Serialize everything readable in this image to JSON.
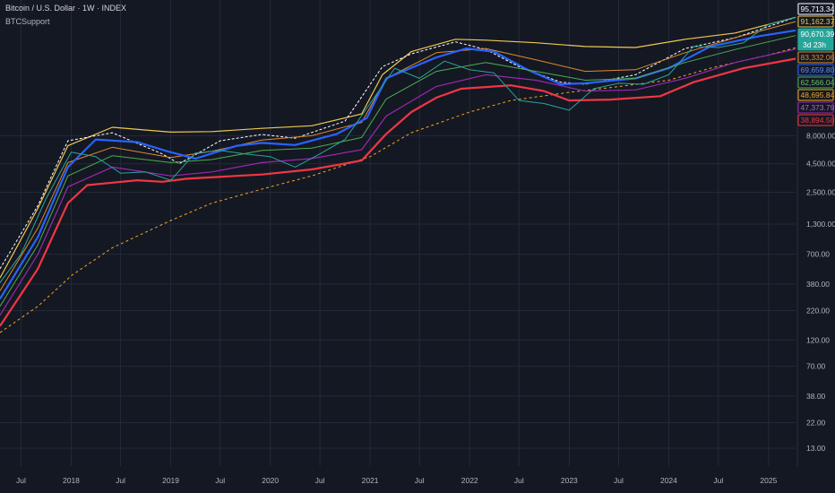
{
  "header": {
    "title": "Bitcoin / U.S. Dollar · 1W · INDEX",
    "indicator": "BTCSupport"
  },
  "colors": {
    "background": "#141823",
    "grid": "#242938",
    "up_candle": "#26a69a",
    "down_candle": "#ef5350"
  },
  "chart_data": {
    "type": "line",
    "title": "Bitcoin / U.S. Dollar · 1W · INDEX",
    "y_scale": "log",
    "grid": true,
    "ylim": [
      9,
      130000
    ],
    "x_range": [
      "2017-04-15",
      "2025-04-10"
    ],
    "y_ticks": [
      "8,000.00",
      "4,500.00",
      "2,500.00",
      "1,300.00",
      "700.00",
      "380.00",
      "220.00",
      "120.00",
      "70.00",
      "38.00",
      "22.00",
      "13.00"
    ],
    "x_ticks": [
      {
        "label": "Jul",
        "date": "2017-07-01"
      },
      {
        "label": "2018",
        "date": "2018-01-01"
      },
      {
        "label": "Jul",
        "date": "2018-07-01"
      },
      {
        "label": "2019",
        "date": "2019-01-01"
      },
      {
        "label": "Jul",
        "date": "2019-07-01"
      },
      {
        "label": "2020",
        "date": "2020-01-01"
      },
      {
        "label": "Jul",
        "date": "2020-07-01"
      },
      {
        "label": "2021",
        "date": "2021-01-01"
      },
      {
        "label": "Jul",
        "date": "2021-07-01"
      },
      {
        "label": "2022",
        "date": "2022-01-01"
      },
      {
        "label": "Jul",
        "date": "2022-07-01"
      },
      {
        "label": "2023",
        "date": "2023-01-01"
      },
      {
        "label": "Jul",
        "date": "2023-07-01"
      },
      {
        "label": "2024",
        "date": "2024-01-01"
      },
      {
        "label": "Jul",
        "date": "2024-07-01"
      },
      {
        "label": "2025",
        "date": "2025-01-01"
      }
    ],
    "price_tags": [
      {
        "value": "95,713.34",
        "price": 95713.34,
        "color": "#ffffff",
        "bg": "#141823",
        "fg": "#ffffff"
      },
      {
        "value": "91,162.37",
        "price": 91162.37,
        "color": "#f0c850",
        "bg": "#141823",
        "fg": "#f0c850"
      },
      {
        "value": "90,670.39",
        "price": 90670.39,
        "color": "#26a69a",
        "bg": "#26a69a",
        "fg": "#ffffff",
        "sub": "3d 23h"
      },
      {
        "value": "83,332.06",
        "price": 83332.06,
        "color": "#e08a2c",
        "bg": "#141823",
        "fg": "#e08a2c"
      },
      {
        "value": "69,659.80",
        "price": 69659.8,
        "color": "#2962ff",
        "bg": "#141823",
        "fg": "#5b8cff"
      },
      {
        "value": "62,566.04",
        "price": 62566.04,
        "color": "#4caf50",
        "bg": "#141823",
        "fg": "#6cc070"
      },
      {
        "value": "48,695.84",
        "price": 48695.84,
        "color": "#f5a623",
        "bg": "#141823",
        "fg": "#f5a623"
      },
      {
        "value": "47,373.79",
        "price": 47373.79,
        "color": "#9c27b0",
        "bg": "#141823",
        "fg": "#b06ad0"
      },
      {
        "value": "38,894.50",
        "price": 38894.5,
        "color": "#f23645",
        "bg": "#141823",
        "fg": "#f23645"
      }
    ],
    "series": [
      {
        "color": "#f0c850",
        "width": 1.2,
        "dash": "",
        "points": [
          [
            "2017-04-15",
            430
          ],
          [
            "2017-09-01",
            1800
          ],
          [
            "2017-12-20",
            6500
          ],
          [
            "2018-06-01",
            9500
          ],
          [
            "2019-01-01",
            8600
          ],
          [
            "2019-06-01",
            8700
          ],
          [
            "2019-12-01",
            9300
          ],
          [
            "2020-06-01",
            9800
          ],
          [
            "2020-12-01",
            12500
          ],
          [
            "2021-02-15",
            28000
          ],
          [
            "2021-06-01",
            45000
          ],
          [
            "2021-11-10",
            58000
          ],
          [
            "2022-03-01",
            57000
          ],
          [
            "2022-09-01",
            54000
          ],
          [
            "2023-03-01",
            50000
          ],
          [
            "2023-09-01",
            49000
          ],
          [
            "2024-03-01",
            58000
          ],
          [
            "2024-09-01",
            66000
          ],
          [
            "2025-04-10",
            91162.37
          ]
        ]
      },
      {
        "color": "#ffffff",
        "width": 1,
        "dash": "3,2",
        "points": [
          [
            "2017-04-15",
            520
          ],
          [
            "2017-09-01",
            1900
          ],
          [
            "2017-12-20",
            7200
          ],
          [
            "2018-06-01",
            8500
          ],
          [
            "2018-12-01",
            5500
          ],
          [
            "2019-02-01",
            4500
          ],
          [
            "2019-07-01",
            7200
          ],
          [
            "2019-12-01",
            8200
          ],
          [
            "2020-04-01",
            7600
          ],
          [
            "2020-10-01",
            10800
          ],
          [
            "2021-02-15",
            33000
          ],
          [
            "2021-06-01",
            43000
          ],
          [
            "2021-11-10",
            55000
          ],
          [
            "2022-03-01",
            47000
          ],
          [
            "2022-07-01",
            33000
          ],
          [
            "2022-12-01",
            24000
          ],
          [
            "2023-03-01",
            23000
          ],
          [
            "2023-09-01",
            28000
          ],
          [
            "2024-03-01",
            48000
          ],
          [
            "2024-09-01",
            60000
          ],
          [
            "2025-04-10",
            91000
          ]
        ]
      },
      {
        "color": "#e08a2c",
        "width": 1,
        "dash": "",
        "points": [
          [
            "2017-04-15",
            330
          ],
          [
            "2017-09-01",
            1200
          ],
          [
            "2017-12-20",
            4600
          ],
          [
            "2018-06-01",
            6300
          ],
          [
            "2019-01-01",
            5100
          ],
          [
            "2019-06-01",
            5800
          ],
          [
            "2019-12-01",
            7300
          ],
          [
            "2020-06-01",
            8000
          ],
          [
            "2020-12-01",
            10500
          ],
          [
            "2021-03-01",
            26000
          ],
          [
            "2021-09-01",
            44000
          ],
          [
            "2022-03-01",
            48000
          ],
          [
            "2022-09-01",
            38000
          ],
          [
            "2023-03-01",
            30000
          ],
          [
            "2023-09-01",
            31000
          ],
          [
            "2024-03-01",
            44000
          ],
          [
            "2024-09-01",
            60000
          ],
          [
            "2025-04-10",
            83332.06
          ]
        ]
      },
      {
        "color": "#2962ff",
        "width": 2.2,
        "dash": "",
        "points": [
          [
            "2017-04-15",
            280
          ],
          [
            "2017-09-01",
            1000
          ],
          [
            "2017-12-20",
            4200
          ],
          [
            "2018-04-01",
            7400
          ],
          [
            "2018-09-01",
            7000
          ],
          [
            "2018-12-20",
            5800
          ],
          [
            "2019-04-01",
            5000
          ],
          [
            "2019-09-01",
            6500
          ],
          [
            "2019-12-01",
            6900
          ],
          [
            "2020-04-01",
            6600
          ],
          [
            "2020-09-01",
            8300
          ],
          [
            "2020-12-20",
            11500
          ],
          [
            "2021-03-01",
            26000
          ],
          [
            "2021-09-01",
            40000
          ],
          [
            "2021-12-20",
            48000
          ],
          [
            "2022-04-01",
            45000
          ],
          [
            "2022-08-01",
            31000
          ],
          [
            "2022-12-01",
            23000
          ],
          [
            "2023-03-01",
            23500
          ],
          [
            "2023-09-01",
            26000
          ],
          [
            "2024-01-01",
            32000
          ],
          [
            "2024-06-01",
            50000
          ],
          [
            "2024-12-01",
            62000
          ],
          [
            "2025-04-10",
            69659.8
          ]
        ]
      },
      {
        "color": "#4caf50",
        "width": 1,
        "dash": "",
        "points": [
          [
            "2017-04-15",
            240
          ],
          [
            "2017-09-01",
            850
          ],
          [
            "2017-12-20",
            3500
          ],
          [
            "2018-06-01",
            5300
          ],
          [
            "2019-01-01",
            4600
          ],
          [
            "2019-06-01",
            4900
          ],
          [
            "2019-12-01",
            5900
          ],
          [
            "2020-06-01",
            6200
          ],
          [
            "2020-12-01",
            7700
          ],
          [
            "2021-03-01",
            17000
          ],
          [
            "2021-09-01",
            30000
          ],
          [
            "2022-03-01",
            36000
          ],
          [
            "2022-09-01",
            30000
          ],
          [
            "2023-03-01",
            25000
          ],
          [
            "2023-09-01",
            26000
          ],
          [
            "2024-03-01",
            36000
          ],
          [
            "2024-09-01",
            47000
          ],
          [
            "2025-04-10",
            62566.04
          ]
        ]
      },
      {
        "color": "#f5a623",
        "width": 1,
        "dash": "3,3",
        "points": [
          [
            "2017-04-15",
            140
          ],
          [
            "2017-09-01",
            240
          ],
          [
            "2018-01-01",
            450
          ],
          [
            "2018-06-01",
            800
          ],
          [
            "2019-01-01",
            1400
          ],
          [
            "2019-06-01",
            2000
          ],
          [
            "2020-01-01",
            2800
          ],
          [
            "2020-06-01",
            3500
          ],
          [
            "2021-01-01",
            5200
          ],
          [
            "2021-06-01",
            8500
          ],
          [
            "2022-01-01",
            13000
          ],
          [
            "2022-06-01",
            16500
          ],
          [
            "2023-01-01",
            19500
          ],
          [
            "2023-06-01",
            21500
          ],
          [
            "2024-01-01",
            25000
          ],
          [
            "2024-06-01",
            32000
          ],
          [
            "2025-01-01",
            42000
          ],
          [
            "2025-04-10",
            48695.84
          ]
        ]
      },
      {
        "color": "#9c27b0",
        "width": 1.2,
        "dash": "",
        "points": [
          [
            "2017-04-15",
            200
          ],
          [
            "2017-09-01",
            700
          ],
          [
            "2017-12-20",
            2800
          ],
          [
            "2018-06-01",
            4200
          ],
          [
            "2019-01-01",
            3500
          ],
          [
            "2019-06-01",
            3800
          ],
          [
            "2019-12-01",
            4600
          ],
          [
            "2020-06-01",
            5000
          ],
          [
            "2020-12-01",
            6000
          ],
          [
            "2021-03-01",
            12000
          ],
          [
            "2021-09-01",
            22000
          ],
          [
            "2022-03-01",
            28000
          ],
          [
            "2022-09-01",
            25000
          ],
          [
            "2023-03-01",
            20000
          ],
          [
            "2023-09-01",
            20500
          ],
          [
            "2024-03-01",
            26000
          ],
          [
            "2024-09-01",
            36000
          ],
          [
            "2025-04-10",
            47373.79
          ]
        ]
      },
      {
        "color": "#f23645",
        "width": 2.2,
        "dash": "",
        "points": [
          [
            "2017-04-15",
            160
          ],
          [
            "2017-09-01",
            520
          ],
          [
            "2017-12-20",
            2000
          ],
          [
            "2018-03-01",
            2900
          ],
          [
            "2018-09-01",
            3200
          ],
          [
            "2018-12-01",
            3100
          ],
          [
            "2019-03-01",
            3300
          ],
          [
            "2019-09-01",
            3500
          ],
          [
            "2019-12-01",
            3600
          ],
          [
            "2020-06-01",
            4000
          ],
          [
            "2020-12-01",
            4800
          ],
          [
            "2021-03-01",
            8300
          ],
          [
            "2021-06-01",
            13000
          ],
          [
            "2021-09-01",
            17500
          ],
          [
            "2021-12-01",
            21000
          ],
          [
            "2022-06-01",
            22500
          ],
          [
            "2022-10-01",
            20000
          ],
          [
            "2023-01-01",
            16500
          ],
          [
            "2023-06-01",
            16800
          ],
          [
            "2023-12-01",
            18000
          ],
          [
            "2024-04-01",
            24000
          ],
          [
            "2024-10-01",
            32000
          ],
          [
            "2025-04-10",
            38894.5
          ]
        ]
      },
      {
        "color": "#26a69a",
        "width": 1,
        "dash": "",
        "points": [
          [
            "2017-04-15",
            390
          ],
          [
            "2017-07-01",
            700
          ],
          [
            "2017-10-01",
            2200
          ],
          [
            "2018-01-01",
            5700
          ],
          [
            "2018-04-01",
            5200
          ],
          [
            "2018-07-01",
            3700
          ],
          [
            "2018-10-01",
            3800
          ],
          [
            "2019-01-01",
            3200
          ],
          [
            "2019-04-01",
            5600
          ],
          [
            "2019-07-01",
            5900
          ],
          [
            "2019-10-01",
            5500
          ],
          [
            "2020-01-01",
            5200
          ],
          [
            "2020-04-01",
            4200
          ],
          [
            "2020-07-01",
            5500
          ],
          [
            "2020-10-01",
            7400
          ],
          [
            "2021-01-01",
            15500
          ],
          [
            "2021-04-01",
            32000
          ],
          [
            "2021-07-01",
            26000
          ],
          [
            "2021-10-01",
            37000
          ],
          [
            "2022-01-01",
            31000
          ],
          [
            "2022-04-01",
            29000
          ],
          [
            "2022-07-01",
            16500
          ],
          [
            "2022-10-01",
            15500
          ],
          [
            "2023-01-01",
            13500
          ],
          [
            "2023-04-01",
            21000
          ],
          [
            "2023-07-01",
            23500
          ],
          [
            "2023-10-01",
            23000
          ],
          [
            "2024-01-01",
            28000
          ],
          [
            "2024-04-01",
            50000
          ],
          [
            "2024-07-01",
            49000
          ],
          [
            "2024-10-01",
            54000
          ],
          [
            "2025-01-01",
            79000
          ],
          [
            "2025-04-10",
            90670.39
          ]
        ]
      }
    ]
  }
}
